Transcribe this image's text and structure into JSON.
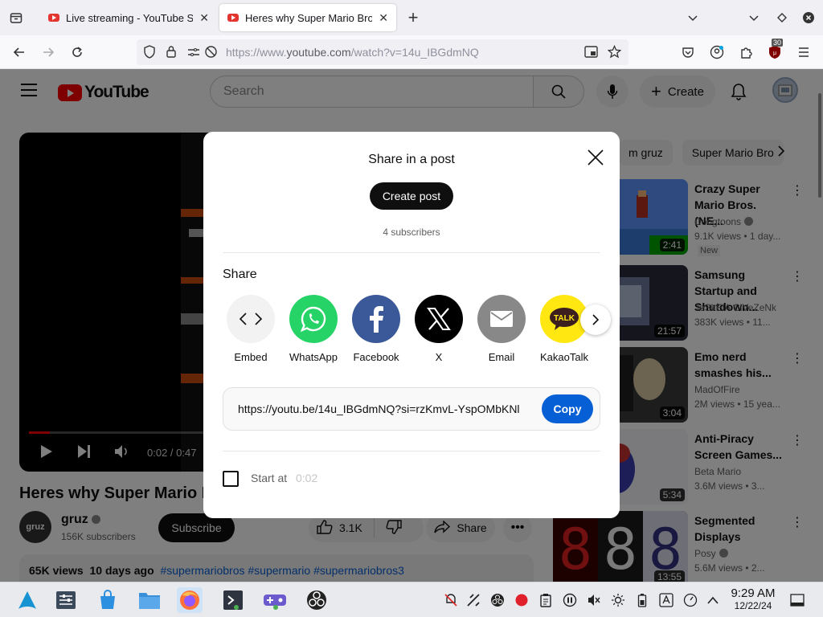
{
  "browser": {
    "tabs": [
      {
        "title": "Live streaming - YouTube Studio",
        "active": false
      },
      {
        "title": "Heres why Super Mario Bros",
        "active": true
      }
    ],
    "new_tab": "+",
    "url_prefix": "https://www.",
    "url_host": "youtube.com",
    "url_rest": "/watch?v=14u_IBGdmNQ",
    "extension_badge": "30"
  },
  "youtube": {
    "logo_text": "YouTube",
    "search_placeholder": "Search",
    "create_label": "Create",
    "chips": [
      "m gruz",
      "Super Mario Bro"
    ],
    "player": {
      "time": "0:02 / 0:47"
    },
    "video_title": "Heres why Super Mario Br",
    "channel": {
      "name": "gruz",
      "subscribers": "156K subscribers",
      "avatar_text": "gruz"
    },
    "subscribe_label": "Subscribe",
    "likes": "3.1K",
    "share_label": "Share",
    "description": {
      "views": "65K views",
      "age": "10 days ago",
      "tags": "#supermariobros #supermario #supermariobros3"
    },
    "recommendations": [
      {
        "title": "Crazy Super Mario Bros. (NE...",
        "channel": "Doogtoons",
        "verified": true,
        "stats": "9.1K views • 1 day...",
        "badge": "New",
        "duration": "2:41"
      },
      {
        "title": "Samsung Startup and Shutdown...",
        "channel": "JeSkElA CiVeZeNk",
        "verified": false,
        "stats": "383K views • 11...",
        "badge": "",
        "duration": "21:57"
      },
      {
        "title": "Emo nerd smashes his...",
        "channel": "MadOfFire",
        "verified": false,
        "stats": "2M views • 15 yea...",
        "badge": "",
        "duration": "3:04"
      },
      {
        "title": "Anti-Piracy Screen Games...",
        "channel": "Beta Mario",
        "verified": false,
        "stats": "3.6M views • 3...",
        "badge": "",
        "duration": "5:34"
      },
      {
        "title": "Segmented Displays",
        "channel": "Posy",
        "verified": true,
        "stats": "5.6M views • 2...",
        "badge": "",
        "duration": "13:55"
      }
    ]
  },
  "share_dialog": {
    "title": "Share in a post",
    "create_post": "Create post",
    "subscribers": "4 subscribers",
    "share_heading": "Share",
    "services": [
      {
        "label": "Embed",
        "icon": "embed-icon",
        "color": "#f2f2f2"
      },
      {
        "label": "WhatsApp",
        "icon": "whatsapp-icon",
        "color": "#25d366"
      },
      {
        "label": "Facebook",
        "icon": "facebook-icon",
        "color": "#3b5998"
      },
      {
        "label": "X",
        "icon": "x-icon",
        "color": "#000000"
      },
      {
        "label": "Email",
        "icon": "email-icon",
        "color": "#888888"
      },
      {
        "label": "KakaoTalk",
        "icon": "kakaotalk-icon",
        "color": "#ffe812"
      }
    ],
    "kakao_text": "TALK",
    "share_url": "https://youtu.be/14u_IBGdmNQ?si=rzKmvL-YspOMbKNl",
    "copy_label": "Copy",
    "start_at_label": "Start at",
    "start_at_time": "0:02"
  },
  "taskbar": {
    "clock_time": "9:29 AM",
    "clock_date": "12/22/24"
  }
}
